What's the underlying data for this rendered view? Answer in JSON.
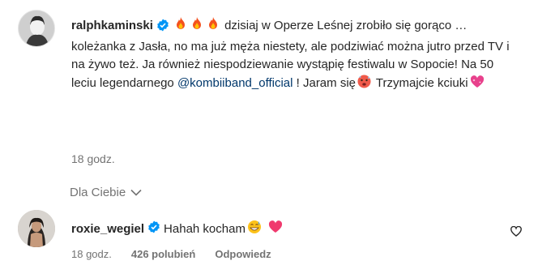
{
  "post": {
    "username": "ralphkaminski",
    "caption_part1": "dzisiaj w Operze Leśnej zrobiło się gorąco … koleżanka z Jasła, no ma już męża niestety, ale podziwiać można jutro przed TV i na żywo też. Ja również niespodziewanie wystąpię festiwalu w Sopocie! Na 50 leciu legendarnego ",
    "mention": "@kombiiband_official",
    "caption_part2": " ! Jaram się",
    "caption_part3": "Trzymajcie kciuki",
    "time": "18 godz.",
    "icons": [
      "verified-badge-icon",
      "fire-emoji",
      "hot-face-emoji",
      "sparkling-heart-emoji"
    ]
  },
  "filter": {
    "label": "Dla Ciebie"
  },
  "reply": {
    "username": "roxie_wegiel",
    "text": "Hahah kocham",
    "time": "18 godz.",
    "likes": "426 polubień",
    "answer": "Odpowiedz",
    "icons": [
      "verified-badge-icon",
      "grinning-sweat-emoji",
      "heart-emoji",
      "heart-outline-icon"
    ]
  },
  "colors": {
    "text": "#262626",
    "muted": "#737373",
    "link": "#00376b",
    "verified": "#0095f6",
    "heart": "#ed4956"
  }
}
